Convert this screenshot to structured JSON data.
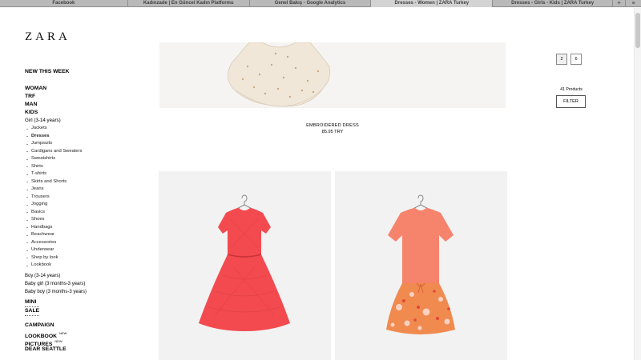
{
  "browser": {
    "tabs": [
      "Facebook",
      "Kadınzade | En Güncel Kadın Platformu",
      "Genel Bakış - Google Analytics",
      "Dresses - Women | ZARA Turkey",
      "Dresses - Girls - Kids | ZARA Turkey"
    ],
    "new_tab": "+",
    "menu": "≡"
  },
  "brand": {
    "logo": "ZARA"
  },
  "nav": {
    "new_this_week": "NEW THIS WEEK",
    "main": [
      "WOMAN",
      "TRF",
      "MAN",
      "KIDS"
    ],
    "girl_heading": "Girl (3-14 years)",
    "girl_items": [
      "Jackets",
      "Dresses",
      "Jumpsuits",
      "Cardigans and Sweaters",
      "Sweatshirts",
      "Shirts",
      "T-shirts",
      "Skirts and Shorts",
      "Jeans",
      "Trousers",
      "Jogging",
      "Basics",
      "Shoes",
      "Handbags",
      "Beachwear",
      "Accessories",
      "Underwear",
      "Shop by look",
      "Lookbook"
    ],
    "other_kids": [
      "Boy (3-14 years)",
      "Baby girl (3 months-3 years)",
      "Baby boy (3 months-3 years)"
    ],
    "mini": "MINI",
    "sale": "SALE",
    "campaign": "CAMPAIGN",
    "lookbook": "LOOKBOOK",
    "pictures": "PICTURES",
    "new_badge": "NEW",
    "dear_seattle": "DEAR SEATTLE"
  },
  "featured": {
    "name": "EMBROIDERED DRESS",
    "price": "85.95 TRY"
  },
  "pagination": {
    "pages": [
      "2",
      "6"
    ]
  },
  "results": {
    "count_text": "41 Products",
    "filter_label": "FILTER"
  },
  "colors": {
    "dress_lace": "#f24a4f",
    "dress_top": "#f6836b",
    "dress_floral": "#f08a4e",
    "hero_dress": "#f1e7d8"
  },
  "icons": [
    "hanger-icon"
  ]
}
